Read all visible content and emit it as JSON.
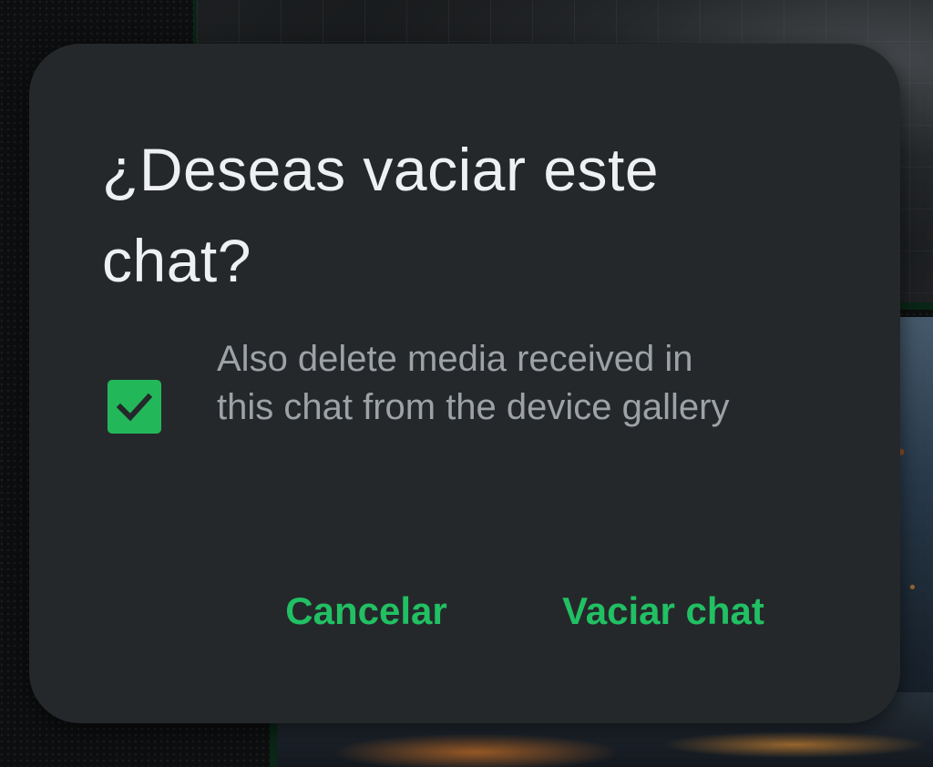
{
  "dialog": {
    "title": "¿Deseas vaciar este chat?",
    "option": {
      "label": "Also delete media received in this chat from the device gallery",
      "checked": true,
      "checkbox_icon": "check-icon"
    },
    "actions": {
      "cancel_label": "Cancelar",
      "confirm_label": "Vaciar chat"
    }
  },
  "colors": {
    "dialog_background": "#25282b",
    "accent_green": "#21c063",
    "checkbox_fill": "#22b85a",
    "title_text": "#eef0f1",
    "secondary_text": "#9da2a6"
  }
}
